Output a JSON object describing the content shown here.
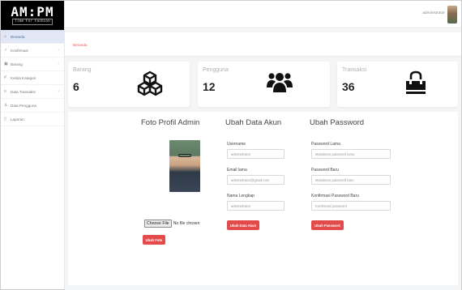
{
  "logo": {
    "main": "AM:PM",
    "sub": "Time For Fashion"
  },
  "sidebar": {
    "items": [
      {
        "label": "Beranda",
        "icon": "home-icon",
        "glyph": "⌂",
        "active": true,
        "chevron": false
      },
      {
        "label": "Konfirmasi",
        "icon": "check-icon",
        "glyph": "✓",
        "active": false,
        "chevron": true
      },
      {
        "label": "Barang",
        "icon": "box-icon",
        "glyph": "▣",
        "active": false,
        "chevron": true
      },
      {
        "label": "Kelola Kategori",
        "icon": "tag-icon",
        "glyph": "#",
        "active": false,
        "chevron": false
      },
      {
        "label": "Data Transaksi",
        "icon": "receipt-icon",
        "glyph": "≡",
        "active": false,
        "chevron": true
      },
      {
        "label": "Data Pengguna",
        "icon": "user-icon",
        "glyph": "♙",
        "active": false,
        "chevron": false
      },
      {
        "label": "Laporan",
        "icon": "file-icon",
        "glyph": "▯",
        "active": false,
        "chevron": false
      }
    ]
  },
  "topbar": {
    "user": "administrator"
  },
  "breadcrumb": "Beranda",
  "stats": [
    {
      "label": "Barang",
      "value": "6",
      "icon": "cubes-icon"
    },
    {
      "label": "Pengguna",
      "value": "12",
      "icon": "users-icon"
    },
    {
      "label": "Transaksi",
      "value": "36",
      "icon": "shopping-bag-icon"
    }
  ],
  "profile": {
    "photo_title": "Foto Profil Admin",
    "file_button": "Choose File",
    "file_status": "No file chosen",
    "upload_button": "Ubah Foto"
  },
  "account": {
    "title": "Ubah Data Akun",
    "username_label": "Username",
    "username_value": "administrator",
    "email_label": "Email lama",
    "email_value": "administrator@gmail.com",
    "fullname_label": "Nama Lengkap",
    "fullname_value": "administrator",
    "submit": "Ubah Data Akun"
  },
  "password": {
    "title": "Ubah Password",
    "old_label": "Password Lama",
    "old_placeholder": "Masukkan password lama",
    "new_label": "Password Baru",
    "new_placeholder": "Masukkan password baru",
    "confirm_label": "Konfirmasi Password Baru",
    "confirm_placeholder": "Konfirmasi password",
    "submit": "Ubah Password"
  },
  "colors": {
    "accent": "#e34b4b",
    "active_nav": "#e1e7f5"
  }
}
